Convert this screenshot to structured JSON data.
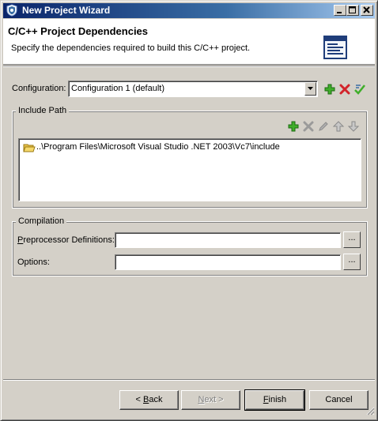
{
  "window": {
    "title": "New Project Wizard",
    "minimize_glyph": "_",
    "maximize_glyph": "□",
    "close_glyph": "×"
  },
  "header": {
    "title": "C/C++ Project Dependencies",
    "description": "Specify the dependencies required to build this C/C++ project."
  },
  "configuration": {
    "label": "Configuration:",
    "selected": "Configuration 1 (default)",
    "icons": [
      "add-configuration-icon",
      "remove-configuration-icon",
      "manage-configurations-icon"
    ]
  },
  "include_path": {
    "legend": "Include Path",
    "toolbar_icons": [
      "add-path-icon",
      "delete-path-icon",
      "edit-path-icon",
      "move-up-icon",
      "move-down-icon"
    ],
    "items": [
      {
        "path": "..\\Program Files\\Microsoft Visual Studio .NET 2003\\Vc7\\include",
        "icon": "folder-icon"
      }
    ]
  },
  "compilation": {
    "legend": "Compilation",
    "preprocessor": {
      "label_prefix": "",
      "label_accel": "P",
      "label_rest": "reprocessor Definitions:",
      "value": "",
      "browse_label": "..."
    },
    "options": {
      "label": "Options:",
      "value": "",
      "browse_label": "..."
    }
  },
  "footer": {
    "back": {
      "prefix": "< ",
      "accel": "B",
      "rest": "ack"
    },
    "next": {
      "prefix": "",
      "accel": "N",
      "rest": "ext >"
    },
    "finish": {
      "prefix": "",
      "accel": "F",
      "rest": "inish"
    },
    "cancel": "Cancel"
  }
}
